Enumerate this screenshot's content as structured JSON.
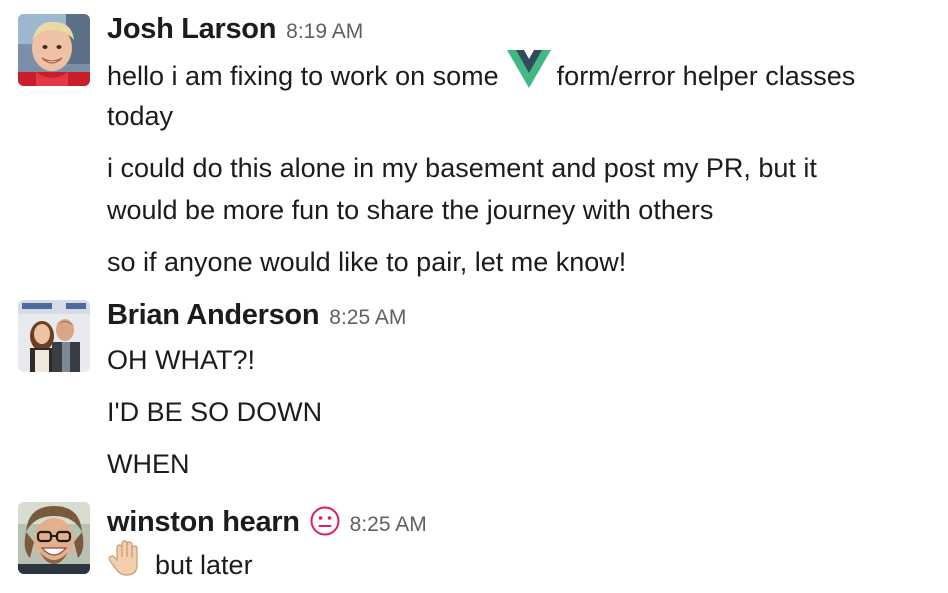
{
  "messages": [
    {
      "sender": "Josh Larson",
      "time": "8:19 AM",
      "avatar": "josh-larson-avatar",
      "lines": {
        "line1_before": "hello i am fixing to work on some",
        "line1_emoji": "vue-logo-icon",
        "line1_after": "form/error helper classes",
        "line2": "today",
        "line3": "i could do this alone in my basement and post my PR, but it",
        "line4": "would be more fun to share the journey with others",
        "line5": "so if anyone would like to pair, let me know!"
      }
    },
    {
      "sender": "Brian Anderson",
      "time": "8:25 AM",
      "avatar": "brian-anderson-avatar",
      "lines": {
        "line1": "OH WHAT?!",
        "line2": "I'D BE SO DOWN",
        "line3": "WHEN"
      }
    },
    {
      "sender": "winston hearn",
      "time": "8:25 AM",
      "status_emoji": "neutral-face-icon",
      "avatar": "winston-hearn-avatar",
      "lines": {
        "line1_emoji": "raised-hand-icon",
        "line1_text": "but later"
      }
    }
  ],
  "colors": {
    "text": "#1d1c1d",
    "timestamp": "#616061",
    "vue_green": "#41b883",
    "vue_dark": "#35495e",
    "status_red": "#e01e5a"
  }
}
